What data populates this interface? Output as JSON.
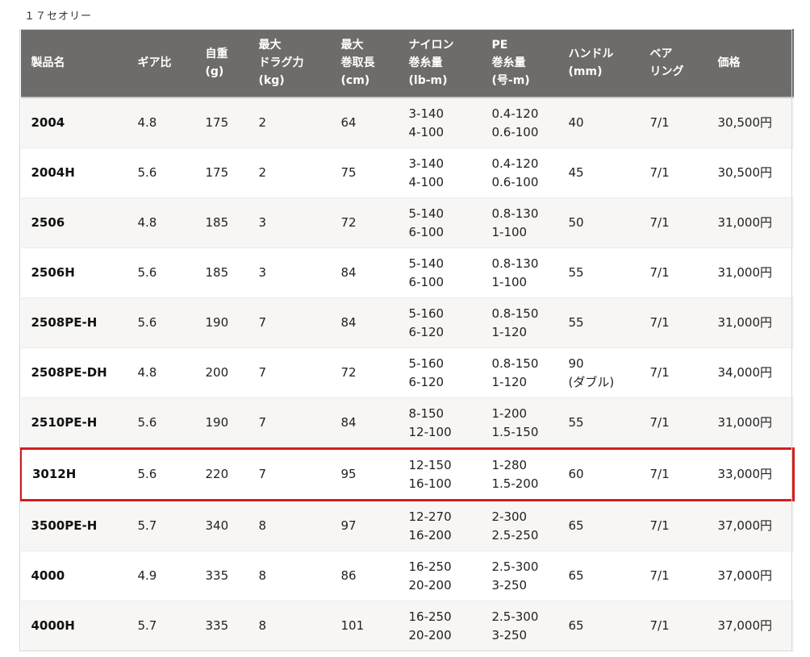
{
  "title": "１７セオリー",
  "columns": [
    "製品名",
    "ギア比",
    "自重\n(g)",
    "最大\nドラグ力\n(kg)",
    "最大\n巻取長\n(cm)",
    "ナイロン\n巻糸量\n(lb-m)",
    "PE\n巻糸量\n(号-m)",
    "ハンドル\n(mm)",
    "ベア\nリング",
    "価格"
  ],
  "rows": [
    [
      "2004",
      "4.8",
      "175",
      "2",
      "64",
      "3-140\n4-100",
      "0.4-120\n0.6-100",
      "40",
      "7/1",
      "30,500円"
    ],
    [
      "2004H",
      "5.6",
      "175",
      "2",
      "75",
      "3-140\n4-100",
      "0.4-120\n0.6-100",
      "45",
      "7/1",
      "30,500円"
    ],
    [
      "2506",
      "4.8",
      "185",
      "3",
      "72",
      "5-140\n6-100",
      "0.8-130\n1-100",
      "50",
      "7/1",
      "31,000円"
    ],
    [
      "2506H",
      "5.6",
      "185",
      "3",
      "84",
      "5-140\n6-100",
      "0.8-130\n1-100",
      "55",
      "7/1",
      "31,000円"
    ],
    [
      "2508PE-H",
      "5.6",
      "190",
      "7",
      "84",
      "5-160\n6-120",
      "0.8-150\n1-120",
      "55",
      "7/1",
      "31,000円"
    ],
    [
      "2508PE-DH",
      "4.8",
      "200",
      "7",
      "72",
      "5-160\n6-120",
      "0.8-150\n1-120",
      "90\n(ダブル)",
      "7/1",
      "34,000円"
    ],
    [
      "2510PE-H",
      "5.6",
      "190",
      "7",
      "84",
      "8-150\n12-100",
      "1-200\n1.5-150",
      "55",
      "7/1",
      "31,000円"
    ],
    [
      "3012H",
      "5.6",
      "220",
      "7",
      "95",
      "12-150\n16-100",
      "1-280\n1.5-200",
      "60",
      "7/1",
      "33,000円"
    ],
    [
      "3500PE-H",
      "5.7",
      "340",
      "8",
      "97",
      "12-270\n16-200",
      "2-300\n2.5-250",
      "65",
      "7/1",
      "37,000円"
    ],
    [
      "4000",
      "4.9",
      "335",
      "8",
      "86",
      "16-250\n20-200",
      "2.5-300\n3-250",
      "65",
      "7/1",
      "37,000円"
    ],
    [
      "4000H",
      "5.7",
      "335",
      "8",
      "101",
      "16-250\n20-200",
      "2.5-300\n3-250",
      "65",
      "7/1",
      "37,000円"
    ]
  ],
  "highlighted_row": 7,
  "colors": {
    "header_bg": "#6e6c6a",
    "header_text": "#ffffff",
    "highlight_border": "#d31e1e",
    "row_alt_bg": "#f7f6f5"
  }
}
